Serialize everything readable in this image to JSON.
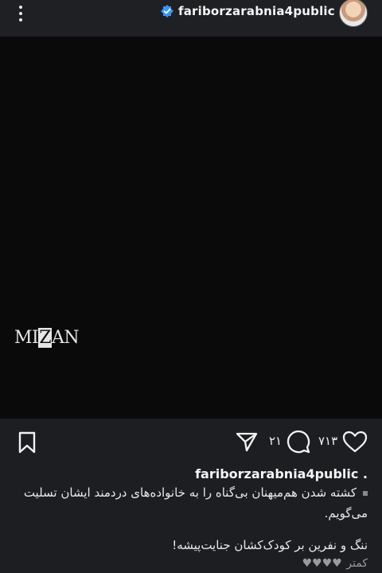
{
  "header": {
    "username": "fariborzarabnia4public",
    "verified": true
  },
  "media": {
    "watermark": {
      "left": "MI",
      "z": "Z",
      "right": "AN"
    }
  },
  "actions": {
    "comment_count": "۲۱",
    "like_count": "۷۱۳"
  },
  "caption": {
    "username": "fariborzarabnia4public .",
    "line1": "کشته شدن هم‌میهنان بی‌گناه را به خانواده‌های دردمند ایشان تسلیت می‌گویم.",
    "line2": "ننگ و نفرین بر کودک‌کشان جنایت‌پیشه!",
    "more": "کمتر",
    "hearts": "♥♥♥♥"
  },
  "colors": {
    "background": "#1c1e22",
    "media": "#0a0a0a",
    "verified": "#3897f0"
  }
}
